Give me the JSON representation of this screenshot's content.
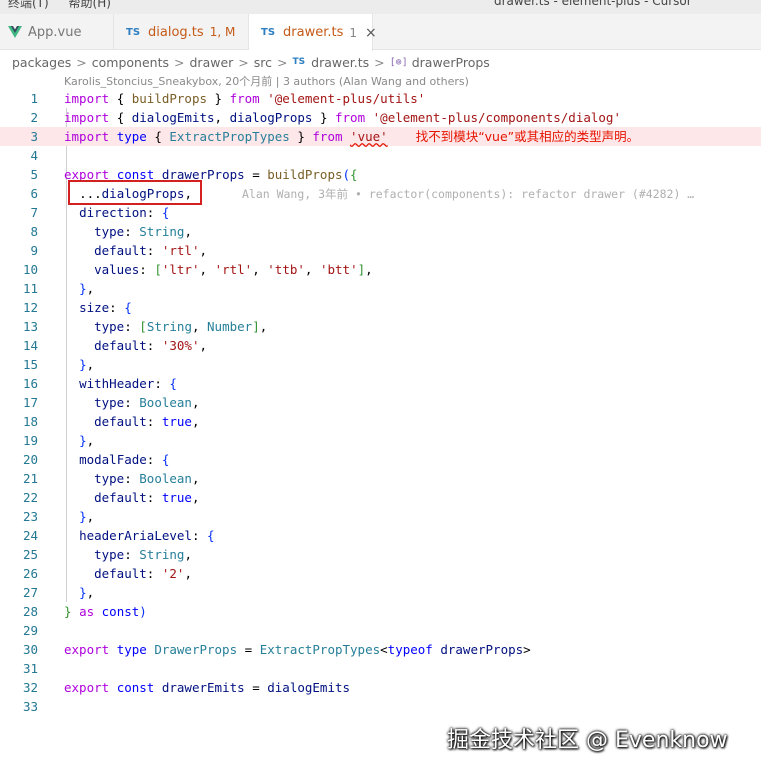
{
  "titlebar": {
    "menu": [
      "终端(T)",
      "帮助(H)"
    ],
    "window_title": "drawer.ts - element-plus - Cursor"
  },
  "tabs": [
    {
      "label": "App.vue",
      "icon": "vue-icon",
      "meta": "",
      "active": false
    },
    {
      "label": "dialog.ts",
      "icon": "ts-icon",
      "meta": "1, M",
      "active": false
    },
    {
      "label": "drawer.ts",
      "icon": "ts-icon",
      "meta": "1",
      "active": true
    }
  ],
  "tab_icon_text": "TS",
  "close_glyph": "×",
  "breadcrumb": {
    "items": [
      "packages",
      "components",
      "drawer",
      "src",
      "drawer.ts",
      "drawerProps"
    ],
    "separator": ">"
  },
  "blame_header": "Karolis_Stoncius_Sneakybox, 20个月前 | 3 authors (Alan Wang and others)",
  "editor": {
    "lines": [
      {
        "n": "1"
      },
      {
        "n": "2"
      },
      {
        "n": "3"
      },
      {
        "n": "4"
      },
      {
        "n": "5"
      },
      {
        "n": "6"
      },
      {
        "n": "7"
      },
      {
        "n": "8"
      },
      {
        "n": "9"
      },
      {
        "n": "10"
      },
      {
        "n": "11"
      },
      {
        "n": "12"
      },
      {
        "n": "13"
      },
      {
        "n": "14"
      },
      {
        "n": "15"
      },
      {
        "n": "16"
      },
      {
        "n": "17"
      },
      {
        "n": "18"
      },
      {
        "n": "19"
      },
      {
        "n": "20"
      },
      {
        "n": "21"
      },
      {
        "n": "22"
      },
      {
        "n": "23"
      },
      {
        "n": "24"
      },
      {
        "n": "25"
      },
      {
        "n": "26"
      },
      {
        "n": "27"
      },
      {
        "n": "28"
      },
      {
        "n": "29"
      },
      {
        "n": "30"
      },
      {
        "n": "31"
      },
      {
        "n": "32"
      },
      {
        "n": "33"
      }
    ],
    "error_message": "找不到模块“vue”或其相应的类型声明。",
    "inline_blame": "Alan Wang, 3年前 • refactor(components): refactor drawer (#4282) …"
  },
  "watermark": "掘金技术社区 @ Evenknow",
  "colors": {
    "keyword": "#0000ff",
    "control_keyword": "#af00db",
    "string": "#a31515",
    "function": "#795e26",
    "identifier": "#001080",
    "type": "#267f99",
    "line_number": "#237893",
    "error": "#e51400",
    "highlight_box": "#d32020",
    "tab_modified": "#c45a18"
  }
}
